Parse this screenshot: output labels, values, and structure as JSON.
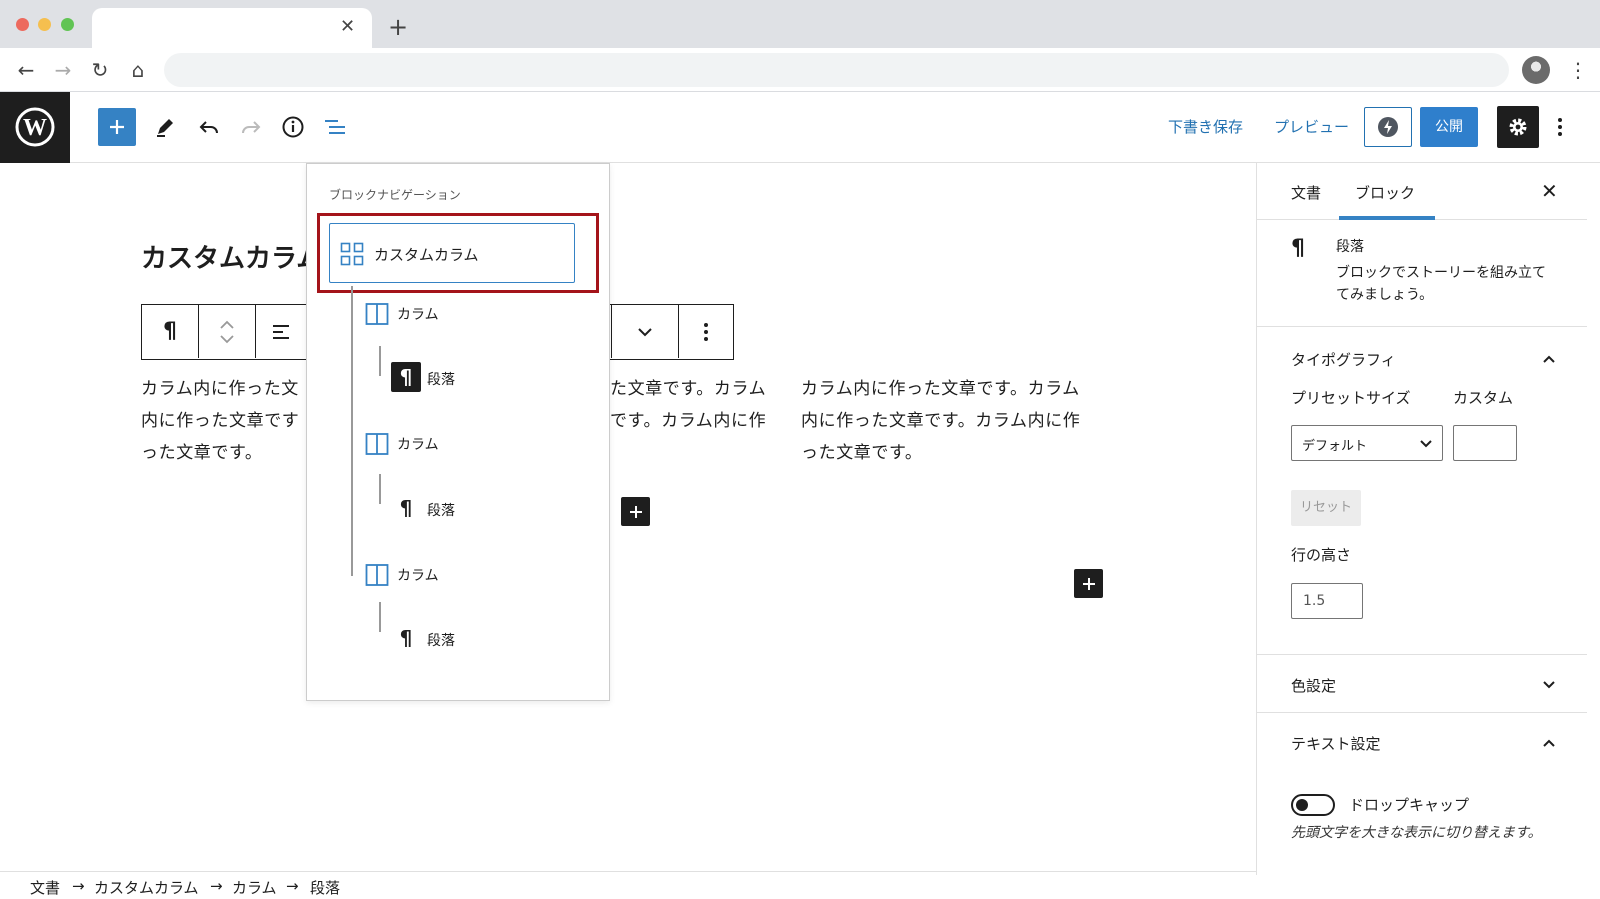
{
  "wp_header": {
    "save_draft": "下書き保存",
    "preview": "プレビュー",
    "publish": "公開"
  },
  "editor": {
    "post_title": "カスタムカラム",
    "columns": [
      {
        "lines": [
          "カラム内に作った文",
          "内に作った文章です",
          "った文章です。"
        ]
      },
      {
        "lines": [
          "た文章です。カラム",
          "です。カラム内に作"
        ]
      },
      {
        "lines": [
          "カラム内に作った文章です。カラム",
          "内に作った文章です。カラム内に作",
          "った文章です。"
        ]
      }
    ]
  },
  "block_navigation": {
    "title": "ブロックナビゲーション",
    "root": "カスタムカラム",
    "items": [
      {
        "label": "カラム",
        "icon": "column-icon",
        "level": 1
      },
      {
        "label": "段落",
        "icon": "paragraph-icon",
        "level": 2,
        "selected": true
      },
      {
        "label": "カラム",
        "icon": "column-icon",
        "level": 1
      },
      {
        "label": "段落",
        "icon": "paragraph-icon",
        "level": 2
      },
      {
        "label": "カラム",
        "icon": "column-icon",
        "level": 1
      },
      {
        "label": "段落",
        "icon": "paragraph-icon",
        "level": 2
      }
    ]
  },
  "sidebar": {
    "tabs": [
      "文書",
      "ブロック"
    ],
    "active_tab": "ブロック",
    "block_card": {
      "title": "段落",
      "desc_line1": "ブロックでストーリーを組み立て",
      "desc_line2": "てみましょう。"
    },
    "typography": {
      "heading": "タイポグラフィ",
      "preset_label": "プリセットサイズ",
      "custom_label": "カスタム",
      "preset_value": "デフォルト",
      "reset": "リセット",
      "line_height_label": "行の高さ",
      "line_height_value": "1.5"
    },
    "color_settings": "色設定",
    "text_settings": {
      "heading": "テキスト設定",
      "dropcap_label": "ドロップキャップ",
      "dropcap_help": "先頭文字を大きな表示に切り替えます。",
      "dropcap_on": false
    }
  },
  "breadcrumbs": [
    "文書",
    "カスタムカラム",
    "カラム",
    "段落"
  ],
  "colors": {
    "accent": "#3582c4",
    "highlight_border": "#a4141a",
    "dark": "#1e1e1e"
  }
}
